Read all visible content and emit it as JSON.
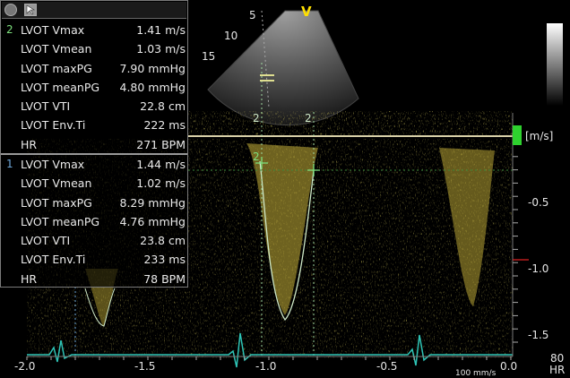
{
  "measurements": {
    "set2": {
      "number": "2",
      "rows": [
        {
          "label": "LVOT Vmax",
          "value": "1.41 m/s"
        },
        {
          "label": "LVOT Vmean",
          "value": "1.03 m/s"
        },
        {
          "label": "LVOT maxPG",
          "value": "7.90 mmHg"
        },
        {
          "label": "LVOT meanPG",
          "value": "4.80 mmHg"
        },
        {
          "label": "LVOT VTI",
          "value": "22.8 cm"
        },
        {
          "label": "LVOT Env.Ti",
          "value": "222 ms"
        },
        {
          "label": "HR",
          "value": "271 BPM"
        }
      ]
    },
    "set1": {
      "number": "1",
      "rows": [
        {
          "label": "LVOT Vmax",
          "value": "1.44 m/s"
        },
        {
          "label": "LVOT Vmean",
          "value": "1.02 m/s"
        },
        {
          "label": "LVOT maxPG",
          "value": "8.29 mmHg"
        },
        {
          "label": "LVOT meanPG",
          "value": "4.76 mmHg"
        },
        {
          "label": "LVOT VTI",
          "value": "23.8 cm"
        },
        {
          "label": "LVOT Env.Ti",
          "value": "233 ms"
        },
        {
          "label": "HR",
          "value": "78 BPM"
        }
      ]
    }
  },
  "sector": {
    "orientation_label": "V",
    "depth_labels": [
      "5",
      "10",
      "15"
    ]
  },
  "velocity_scale": {
    "unit": "[m/s]",
    "ticks": [
      "-0.5",
      "-1.0",
      "-1.5"
    ]
  },
  "time_axis": {
    "ticks": [
      "-2.0",
      "-1.5",
      "-1.0",
      "-0.5",
      "0.0"
    ],
    "sweep_speed": "100 mm/s"
  },
  "hr_readout": {
    "value": "80",
    "label": "HR"
  },
  "caliper_labels": [
    "2",
    "2"
  ],
  "colors": {
    "doppler": "#c9b33a",
    "ecg": "#2ec4b6",
    "envelope": "#cfe9c8",
    "baseline": "#d8d0a8",
    "caliper": "#7de07d",
    "marker": "#2ed12e"
  },
  "icons": [
    "record-icon",
    "cursor-icon"
  ]
}
